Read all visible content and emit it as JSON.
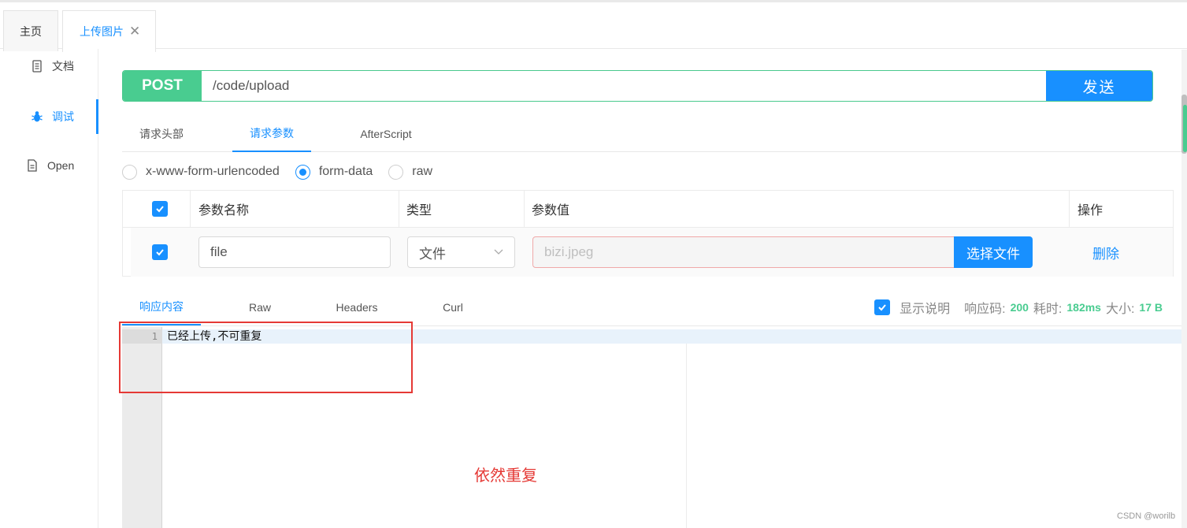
{
  "tabs": [
    {
      "label": "主页"
    },
    {
      "label": "上传图片"
    }
  ],
  "sidebar": {
    "items": [
      {
        "label": "文档"
      },
      {
        "label": "调试"
      },
      {
        "label": "Open"
      }
    ]
  },
  "request": {
    "method": "POST",
    "url": "/code/upload",
    "send_label": "发送"
  },
  "request_tabs": [
    {
      "label": "请求头部"
    },
    {
      "label": "请求参数"
    },
    {
      "label": "AfterScript"
    }
  ],
  "body_types": [
    {
      "label": "x-www-form-urlencoded",
      "selected": false
    },
    {
      "label": "form-data",
      "selected": true
    },
    {
      "label": "raw",
      "selected": false
    }
  ],
  "params_table": {
    "headers": [
      "参数名称",
      "类型",
      "参数值",
      "操作"
    ],
    "rows": [
      {
        "checked": true,
        "name": "file",
        "type": "文件",
        "value_placeholder": "bizi.jpeg",
        "choose_label": "选择文件",
        "action": "删除"
      }
    ]
  },
  "response_tabs": [
    {
      "label": "响应内容"
    },
    {
      "label": "Raw"
    },
    {
      "label": "Headers"
    },
    {
      "label": "Curl"
    }
  ],
  "response_info": {
    "show_desc_label": "显示说明",
    "status_label": "响应码:",
    "status_value": "200",
    "time_label": "耗时:",
    "time_value": "182ms",
    "size_label": "大小:",
    "size_value": "17 B"
  },
  "editor": {
    "line_number": "1",
    "content": "已经上传,不可重复"
  },
  "annotation": {
    "note": "依然重复",
    "highlight_color": "#e53935"
  },
  "watermark": "CSDN @worilb",
  "colors": {
    "accent": "#1890ff",
    "post": "#49cc90"
  }
}
